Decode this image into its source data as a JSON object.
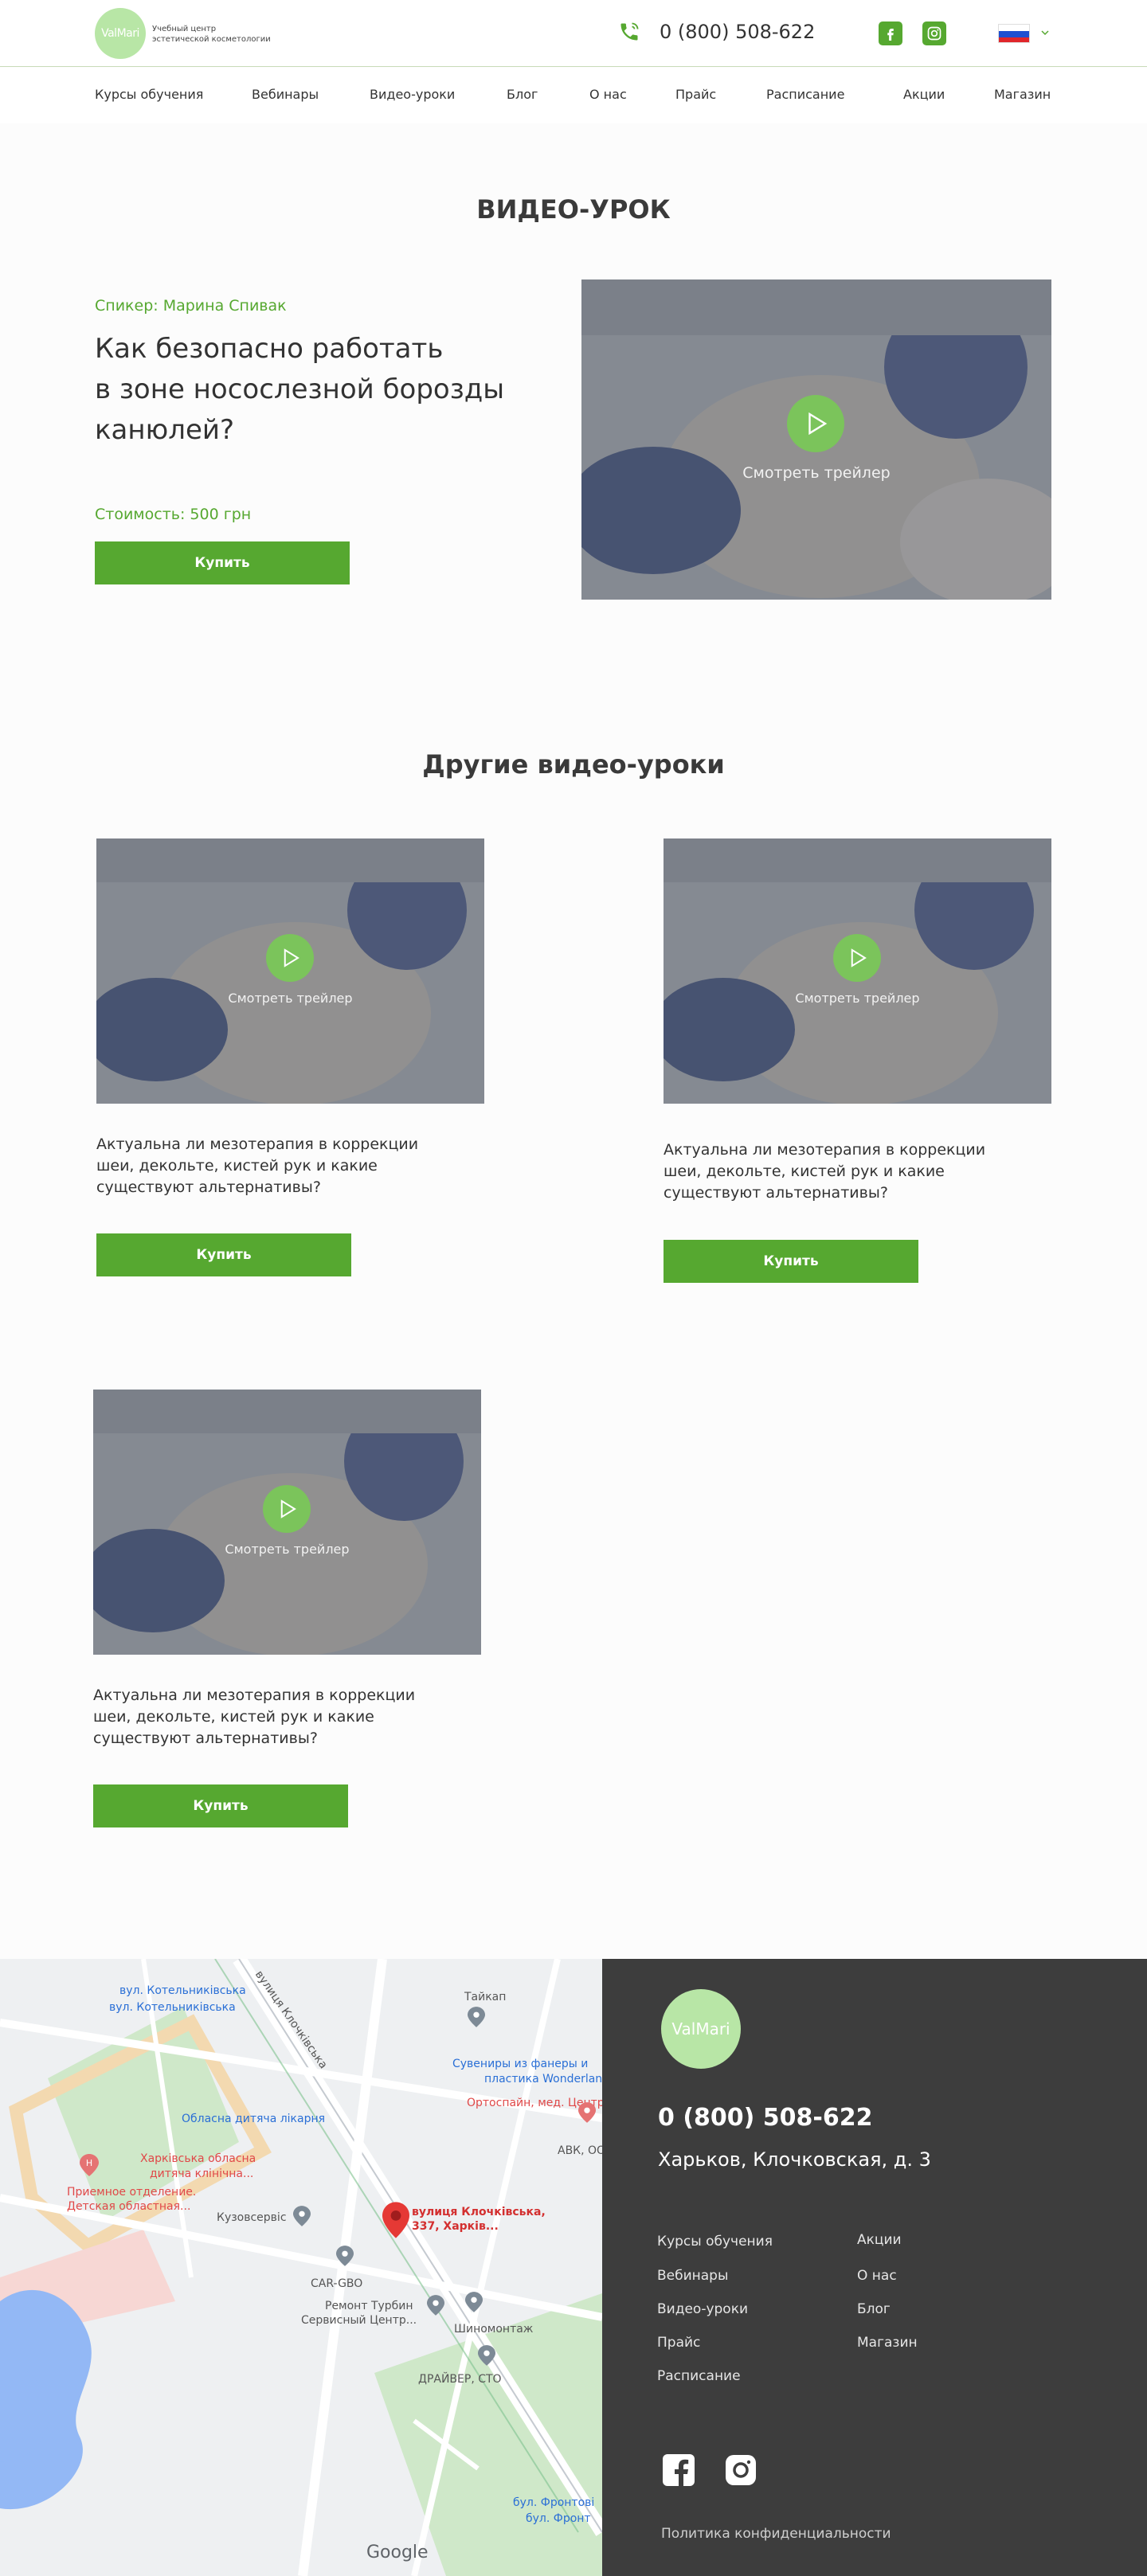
{
  "header": {
    "logo": "ValMari",
    "logo_caption_1": "Учебный центр",
    "logo_caption_2": "эстетической косметологии",
    "phone": "0 (800) 508-622"
  },
  "nav": [
    "Курсы обучения",
    "Вебинары",
    "Видео-уроки",
    "Блог",
    "О нас",
    "Прайс",
    "Расписание",
    "Акции",
    "Магазин"
  ],
  "hero": {
    "section_title": "ВИДЕО-УРОК",
    "speaker": "Спикер: Марина Спивак",
    "title_line_1": "Как безопасно работать",
    "title_line_2": "в зоне носослезной борозды",
    "title_line_3": "канюлей?",
    "price": "Стоимость: 500 грн",
    "buy_label": "Купить",
    "trailer_label": "Смотреть трейлер"
  },
  "others": {
    "section_title": "Другие видео-уроки",
    "cards": [
      {
        "line_1": "Актуальна ли мезотерапия в коррекции",
        "line_2": "шеи, декольте, кистей рук и какие",
        "line_3": "существуют альтернативы?",
        "buy_label": "Купить",
        "trailer_label": "Смотреть трейлер"
      },
      {
        "line_1": "Актуальна ли мезотерапия в коррекции",
        "line_2": "шеи, декольте, кистей рук и какие",
        "line_3": "существуют альтернативы?",
        "buy_label": "Купить",
        "trailer_label": "Смотреть трейлер"
      },
      {
        "line_1": "Актуальна ли мезотерапия в коррекции",
        "line_2": "шеи, декольте, кистей рук и какие",
        "line_3": "существуют альтернативы?",
        "buy_label": "Купить",
        "trailer_label": "Смотреть трейлер"
      }
    ]
  },
  "map": {
    "labels": [
      "вул. Котельниківська",
      "вул. Котельниківська",
      "вулиця Клочківська",
      "Тайкап",
      "Сувениры из фанеры и",
      "пластика Wonderland",
      "Ортоспайн, мед. Центр",
      "Обласна дитяча лікарня",
      "Харківська обласна",
      "дитяча клінічна...",
      "Приемное отделение.",
      "Детская областная...",
      "АВК, ООО",
      "Кузовсервіс",
      "вулиця Клочківська,",
      "337, Харків...",
      "CAR-GBO",
      "Ремонт Турбин",
      "Сервисный Центр...",
      "Шиномонтаж",
      "ДРАЙВЕР, СТО",
      "бул. Фронтові",
      "бул. Фронт",
      "Google"
    ]
  },
  "footer": {
    "logo": "ValMari",
    "phone": "0 (800) 508-622",
    "address": "Харьков, Клочковская, д. 3",
    "links_left": [
      "Курсы обучения",
      "Вебинары",
      "Видео-уроки",
      "Прайс",
      "Расписание"
    ],
    "links_right": [
      "Акции",
      "О нас",
      "Блог",
      "Магазин"
    ],
    "privacy": "Политика конфиденциальности"
  },
  "colors": {
    "accent": "#56a830",
    "logo_bg": "#b8e6a6",
    "footer_bg": "#3d3d3d"
  }
}
